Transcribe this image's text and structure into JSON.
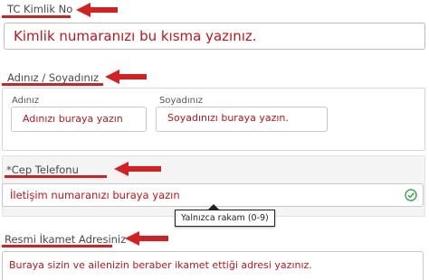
{
  "tc_section": {
    "label": "TC Kimlik No",
    "input_text": "Kimlik numaranızı bu kısma yazınız."
  },
  "name_section": {
    "label": "Adınız / Soyadınız",
    "first_name_label": "Adınız",
    "first_name_text": "Adınızı buraya yazın",
    "last_name_label": "Soyadınız",
    "last_name_text": "Soyadınızı buraya yazın."
  },
  "phone_section": {
    "label": "*Cep Telefonu",
    "input_text": "İletişim numaranızı buraya yazın",
    "tooltip": "Yalnızca rakam (0-9)"
  },
  "address_section": {
    "label": "Resmi İkamet Adresiniz",
    "input_text": "Buraya sizin ve ailenizin beraber ikamet ettiği adresi yazınız."
  },
  "colors": {
    "annotation_red": "#d42020",
    "input_text_red": "#c0151b",
    "valid_green": "#3aa64a"
  },
  "icons": [
    "red-arrow-icon",
    "check-circle-icon"
  ]
}
